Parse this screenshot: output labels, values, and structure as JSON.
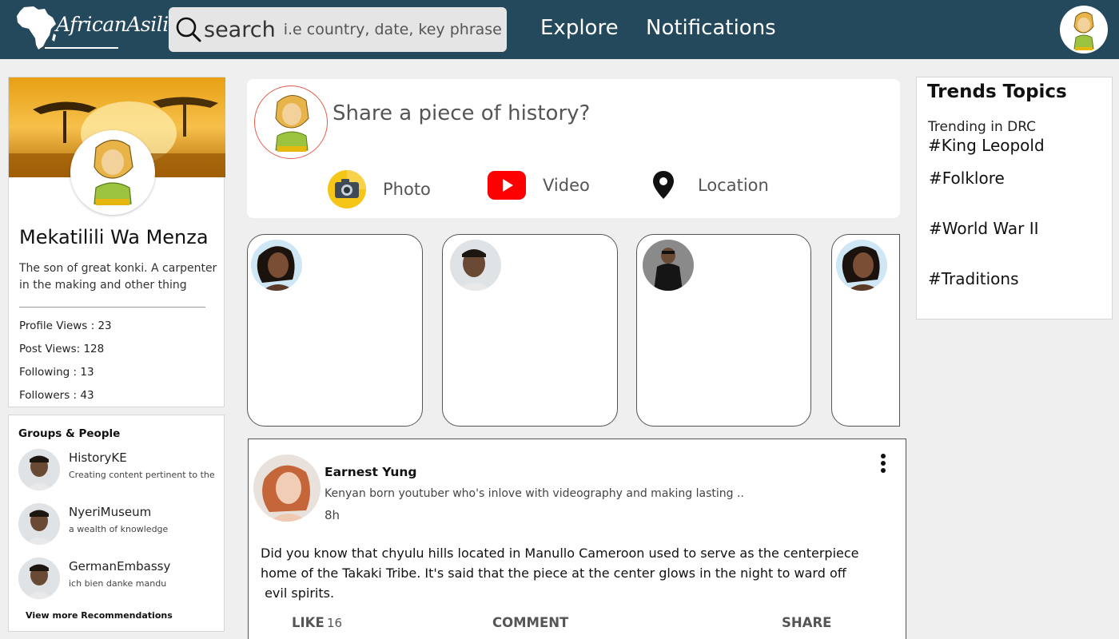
{
  "header": {
    "logo_text": "AfricanAsili",
    "search_word": "search",
    "search_hint": "i.e country, date, key phrase",
    "nav_explore": "Explore",
    "nav_notifications": "Notifications"
  },
  "profile": {
    "name": "Mekatilili Wa Menza",
    "bio": "The son of great konki. A carpenter in the making and other thing",
    "stats": [
      {
        "label": "Profile Views : 23"
      },
      {
        "label": "Post Views: 128"
      },
      {
        "label": "Following : 13"
      },
      {
        "label": "Followers : 43"
      }
    ]
  },
  "groups": {
    "title": "Groups & People",
    "items": [
      {
        "name": "HistoryKE",
        "desc": "Creating content pertinent to the"
      },
      {
        "name": "NyeriMuseum",
        "desc": "a wealth of knowledge"
      },
      {
        "name": "GermanEmbassy",
        "desc": "ich bien danke mandu"
      }
    ],
    "view_more": "View more Recommendations"
  },
  "composer": {
    "prompt": "Share a piece of history?",
    "photo": "Photo",
    "video": "Video",
    "location": "Location"
  },
  "trends": {
    "title": "Trends Topics",
    "subtitle": "Trending in DRC",
    "items": [
      "#King Leopold",
      "#Folklore",
      "#World War II",
      "#Traditions"
    ]
  },
  "post": {
    "author": "Earnest Yung",
    "bio": "Kenyan born youtuber who's inlove with videography and making lasting ..",
    "time": "8h",
    "body_line1": "Did you know that chyulu hills located in Manullo Cameroon used to serve as the centerpiece",
    "body_line2": "home of the Takaki Tribe. It's said that the piece at the center glows in the night to ward off",
    "body_line3": " evil spirits.",
    "like_label": "LIKE",
    "like_count": "16",
    "comment_label": "COMMENT",
    "share_label": "SHARE"
  },
  "colors": {
    "header_bg": "#24485c",
    "accent_red": "#e15b4a"
  }
}
